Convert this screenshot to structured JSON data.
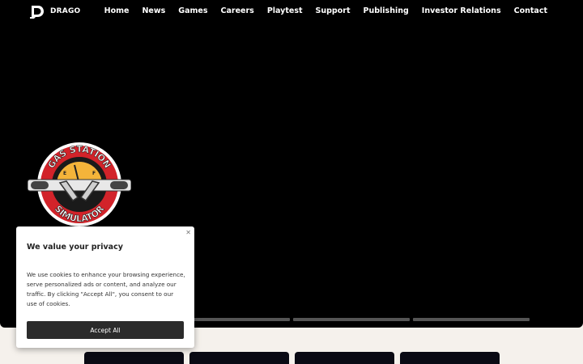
{
  "nav": {
    "brand": "DRAGO",
    "items": [
      {
        "label": "Home"
      },
      {
        "label": "News"
      },
      {
        "label": "Games"
      },
      {
        "label": "Careers"
      },
      {
        "label": "Playtest"
      },
      {
        "label": "Support"
      },
      {
        "label": "Publishing"
      },
      {
        "label": "Investor Relations"
      },
      {
        "label": "Contact"
      }
    ]
  },
  "hero": {
    "logo": {
      "line1": "GAS STATION",
      "line2": "SIMULATOR"
    },
    "slides": 4
  },
  "cookie": {
    "title": "We value your privacy",
    "body": "We use cookies to enhance your browsing experience, serve personalized ads or content, and analyze our traffic. By clicking \"Accept All\", you consent to our use of cookies.",
    "accept_label": "Accept All",
    "close_icon": "close-icon"
  },
  "colors": {
    "hero_bg": "#000000",
    "page_bg": "#f5f1ec",
    "logo_red": "#d2232a",
    "logo_yellow": "#f4b43a",
    "button_bg": "#2b2b2b"
  }
}
